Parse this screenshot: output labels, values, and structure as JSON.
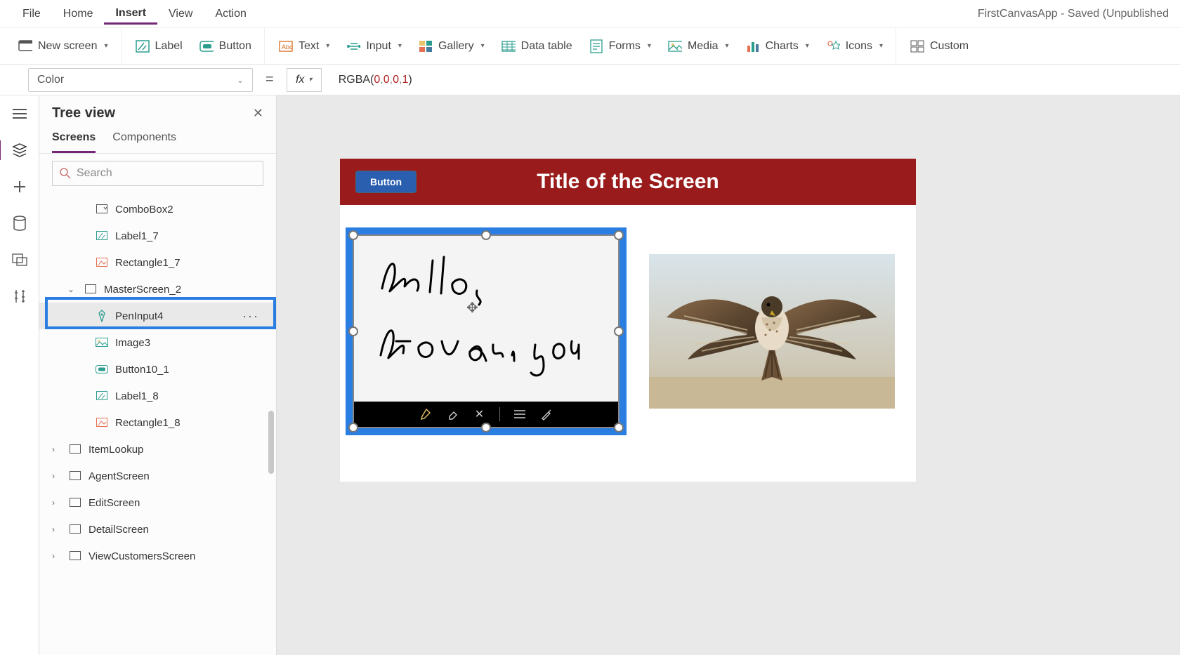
{
  "app_title": "FirstCanvasApp - Saved (Unpublished",
  "top_menu": {
    "items": [
      "File",
      "Home",
      "Insert",
      "View",
      "Action"
    ],
    "active": "Insert"
  },
  "ribbon": {
    "new_screen": "New screen",
    "label": "Label",
    "button": "Button",
    "text": "Text",
    "input": "Input",
    "gallery": "Gallery",
    "data_table": "Data table",
    "forms": "Forms",
    "media": "Media",
    "charts": "Charts",
    "icons": "Icons",
    "custom": "Custom"
  },
  "formula": {
    "property": "Color",
    "fn": "RGBA",
    "args": [
      "0",
      "0",
      "0",
      "1"
    ]
  },
  "tree": {
    "title": "Tree view",
    "tabs": {
      "screens": "Screens",
      "components": "Components",
      "active": "Screens"
    },
    "search_placeholder": "Search",
    "items": [
      {
        "level": 2,
        "icon": "combobox",
        "label": "ComboBox2"
      },
      {
        "level": 2,
        "icon": "label",
        "label": "Label1_7"
      },
      {
        "level": 2,
        "icon": "rectangle",
        "label": "Rectangle1_7"
      },
      {
        "level": 1,
        "icon": "screen",
        "label": "MasterScreen_2",
        "expanded": true
      },
      {
        "level": 2,
        "icon": "pen",
        "label": "PenInput4",
        "selected": true
      },
      {
        "level": 2,
        "icon": "image",
        "label": "Image3"
      },
      {
        "level": 2,
        "icon": "button",
        "label": "Button10_1"
      },
      {
        "level": 2,
        "icon": "label",
        "label": "Label1_8"
      },
      {
        "level": 2,
        "icon": "rectangle",
        "label": "Rectangle1_8"
      },
      {
        "level": 0,
        "icon": "screen",
        "label": "ItemLookup",
        "collapsed": true
      },
      {
        "level": 0,
        "icon": "screen",
        "label": "AgentScreen",
        "collapsed": true
      },
      {
        "level": 0,
        "icon": "screen",
        "label": "EditScreen",
        "collapsed": true
      },
      {
        "level": 0,
        "icon": "screen",
        "label": "DetailScreen",
        "collapsed": true
      },
      {
        "level": 0,
        "icon": "screen",
        "label": "ViewCustomersScreen",
        "collapsed": true
      }
    ]
  },
  "canvas": {
    "header_button": "Button",
    "header_title": "Title of the Screen",
    "handwriting_lines": [
      "Hello,",
      "How are you"
    ]
  }
}
